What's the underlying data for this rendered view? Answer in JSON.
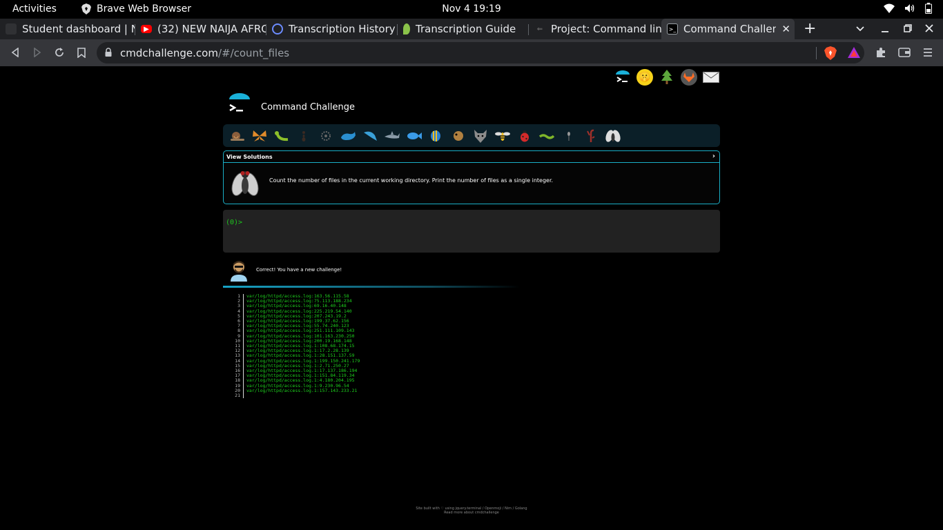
{
  "system_bar": {
    "activities": "Activities",
    "app_name": "Brave Web Browser",
    "datetime": "Nov 4  19:19"
  },
  "tabs": [
    {
      "title": "Student dashboard | N",
      "favicon": "",
      "active": false
    },
    {
      "title": "(32) NEW NAIJA AFRO",
      "favicon": "youtube-icon",
      "active": false
    },
    {
      "title": "Transcription History",
      "favicon": "globe-icon",
      "active": false
    },
    {
      "title": "Transcription Guide",
      "favicon": "leaf-icon",
      "active": false
    },
    {
      "title": "Project: Command line",
      "favicon": "",
      "active": false
    },
    {
      "title": "Command Challeng",
      "favicon": "terminal-icon",
      "active": true
    }
  ],
  "address_bar": {
    "domain": "cmdchallenge.com",
    "path": "/#/count_files"
  },
  "page": {
    "site_title": "Command Challenge",
    "view_solutions": "View Solutions",
    "challenge_text": "Count the number of files in the current working directory. Print the number of files as a single integer.",
    "terminal_prompt": "(0)>",
    "result_message": "Correct! You have a new challenge!",
    "footer_line1": "Site built with ♡ using jquery.terminal / Openmoji / Nim / Golang",
    "footer_line2": "Read more about cmdchallenge"
  },
  "output": {
    "line_numbers": [
      "1",
      "2",
      "3",
      "4",
      "5",
      "6",
      "7",
      "8",
      "9",
      "10",
      "11",
      "12",
      "13",
      "14",
      "15",
      "16",
      "17",
      "18",
      "19",
      "20",
      "21"
    ],
    "lines": [
      "var/log/httpd/access.log:163.56.115.58",
      "var/log/httpd/access.log:75.113.188.234",
      "var/log/httpd/access.log:69.16.40.148",
      "var/log/httpd/access.log:225.219.54.140",
      "var/log/httpd/access.log:207.243.19.2",
      "var/log/httpd/access.log:199.37.62.156",
      "var/log/httpd/access.log:55.74.240.123",
      "var/log/httpd/access.log:251.111.109.143",
      "var/log/httpd/access.log:101.163.230.250",
      "var/log/httpd/access.log:200.19.168.148",
      "var/log/httpd/access.log.1:108.68.174.15",
      "var/log/httpd/access.log.1:17.2.28.139",
      "var/log/httpd/access.log.1:28.151.137.59",
      "var/log/httpd/access.log.1:199.150.241.179",
      "var/log/httpd/access.log.1:2.71.250.27",
      "var/log/httpd/access.log.1:17.137.186.194",
      "var/log/httpd/access.log.1:151.84.119.34",
      "var/log/httpd/access.log.1:4.180.204.195",
      "var/log/httpd/access.log.1:9.230.96.54",
      "var/log/httpd/access.log.1:157.143.233.21",
      ""
    ]
  },
  "challenge_icons": [
    "snail-icon",
    "butterfly-icon",
    "caterpillar-icon",
    "ant-icon",
    "gear-icon",
    "whale-icon",
    "dolphin-icon",
    "shark-icon",
    "fish-icon",
    "tropical-fish-icon",
    "blowfish-icon",
    "wolf-icon",
    "bee-icon",
    "ladybug-icon",
    "worm-icon",
    "mosquito-icon",
    "scorpion-icon",
    "fly-icon"
  ],
  "colors": {
    "accent": "#1ab0c8",
    "terminal_green": "#1ec81e",
    "page_bg": "#000000",
    "chrome_dark": "#202124",
    "chrome_mid": "#35363a"
  }
}
